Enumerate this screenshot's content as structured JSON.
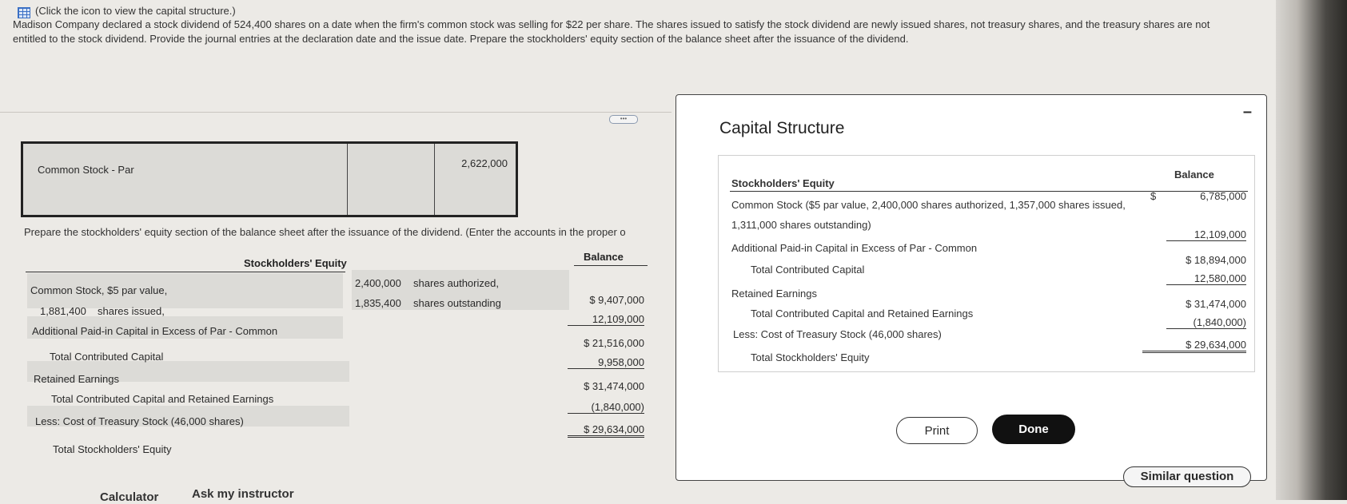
{
  "hint": "(Click the icon to view the capital structure.)",
  "problem": "Madison Company declared a stock dividend of 524,400 shares on a date when the firm's common stock was selling for $22 per share. The shares issued to satisfy the stock dividend are newly issued shares, not treasury shares, and the treasury shares are not entitled to the stock dividend. Provide the journal entries at the declaration date and the issue date. Prepare the stockholders' equity section of the balance sheet after the issuance of the dividend.",
  "journal": {
    "account": "Common Stock - Par",
    "credit": "2,622,000"
  },
  "prepare": "Prepare the stockholders' equity section of the balance sheet after the issuance of the dividend. (Enter the accounts in the proper o",
  "equity": {
    "header": "Stockholders' Equity",
    "balance_header": "Balance",
    "common_stock_line1": "Common Stock, $5 par value,",
    "issued_value": "1,881,400",
    "issued_label": "shares issued,",
    "authorized_value": "2,400,000",
    "authorized_label": "shares authorized,",
    "outstanding_value": "1,835,400",
    "outstanding_label": "shares outstanding",
    "rows": [
      {
        "label": "Additional Paid-in Capital in Excess of Par - Common"
      },
      {
        "label": "Total Contributed Capital"
      },
      {
        "label": "Retained Earnings"
      },
      {
        "label": "Total Contributed Capital and Retained Earnings"
      },
      {
        "label": "Less: Cost of Treasury Stock (46,000 shares)"
      },
      {
        "label": "Total Stockholders' Equity"
      }
    ],
    "values": [
      "$ 9,407,000",
      "12,109,000",
      "$ 21,516,000",
      "9,958,000",
      "$ 31,474,000",
      "(1,840,000)",
      "$ 29,634,000"
    ]
  },
  "popup": {
    "title": "Capital Structure",
    "header": "Stockholders' Equity",
    "balance": "Balance",
    "common1": "Common Stock ($5 par value, 2,400,000 shares authorized, 1,357,000 shares issued,",
    "common2": "1,311,000 shares outstanding)",
    "common_dollar": "$",
    "common_val": "6,785,000",
    "apic": "Additional Paid-in Capital in Excess of Par - Common",
    "apic_val": "12,109,000",
    "tcc": "Total Contributed Capital",
    "tcc_val": "$ 18,894,000",
    "re": "Retained Earnings",
    "re_val": "12,580,000",
    "tccre": "Total Contributed Capital and Retained Earnings",
    "tccre_val": "$ 31,474,000",
    "treasury": "Less: Cost of Treasury Stock (46,000 shares)",
    "treasury_val": "(1,840,000)",
    "tse": "Total Stockholders' Equity",
    "tse_val": "$ 29,634,000",
    "print": "Print",
    "done": "Done"
  },
  "similar": "Similar question",
  "ask": "Ask my instructor",
  "calc": "Calculator"
}
